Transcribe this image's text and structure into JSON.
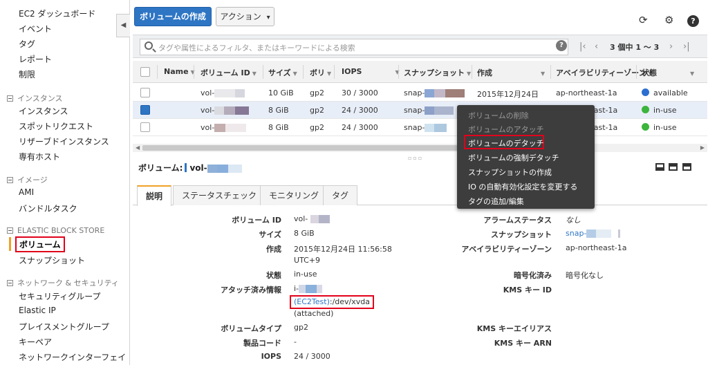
{
  "sidebar": {
    "links_top": [
      "EC2 ダッシュボード",
      "イベント",
      "タグ",
      "レポート",
      "制限"
    ],
    "groups": [
      {
        "title": "インスタンス",
        "items": [
          "インスタンス",
          "スポットリクエスト",
          "リザーブドインスタンス",
          "専有ホスト"
        ]
      },
      {
        "title": "イメージ",
        "items": [
          "AMI",
          "バンドルタスク"
        ]
      },
      {
        "title": "ELASTIC BLOCK STORE",
        "items": [
          "ボリューム",
          "スナップショット"
        ]
      },
      {
        "title": "ネットワーク & セキュリティ",
        "items": [
          "セキュリティグループ",
          "Elastic IP",
          "プレイスメントグループ",
          "キーペア",
          "ネットワークインターフェイ"
        ]
      }
    ],
    "active_item": "ボリューム"
  },
  "toolbar": {
    "create_volume": "ボリュームの作成",
    "actions": "アクション",
    "actions_caret": "▾"
  },
  "search": {
    "placeholder": "タグや属性によるフィルタ、またはキーワードによる検索",
    "help": "?",
    "pager_text": "3 個中 1 ～ 3"
  },
  "grid": {
    "columns": [
      "Name",
      "ボリューム ID",
      "サイズ",
      "ボリ",
      "IOPS",
      "スナップショット",
      "作成",
      "アベイラビリティーゾーン",
      "状態"
    ],
    "rows": [
      {
        "volume_id": "vol-",
        "size": "10 GiB",
        "type": "gp2",
        "iops": "30 / 3000",
        "snapshot": "snap-",
        "created": "2015年12月24日",
        "az": "ap-northeast-1a",
        "state": "available",
        "state_color": "#2c6fd1",
        "selected": false
      },
      {
        "volume_id": "vol-",
        "size": "8 GiB",
        "type": "gp2",
        "iops": "24 / 3000",
        "snapshot": "snap-",
        "created": "",
        "az": "heast-1a",
        "state": "in-use",
        "state_color": "#3bb53b",
        "selected": true
      },
      {
        "volume_id": "vol-",
        "size": "8 GiB",
        "type": "gp2",
        "iops": "24 / 3000",
        "snapshot": "snap-",
        "created": "",
        "az": "heast-1a",
        "state": "in-use",
        "state_color": "#3bb53b",
        "selected": false
      }
    ]
  },
  "context_menu": {
    "items": [
      "ボリュームの削除",
      "ボリュームのアタッチ",
      "ボリュームのデタッチ",
      "ボリュームの強制デタッチ",
      "スナップショットの作成",
      "IO の自動有効化設定を変更する",
      "タグの追加/編集"
    ],
    "highlighted": "ボリュームのデタッチ"
  },
  "detail": {
    "title_label": "ボリューム:",
    "title_value": "vol-",
    "tabs": [
      "説明",
      "ステータスチェック",
      "モニタリング",
      "タグ"
    ],
    "left": {
      "volume_id_label": "ボリューム ID",
      "volume_id": "vol-",
      "size_label": "サイズ",
      "size": "8 GiB",
      "created_label": "作成",
      "created_1": "2015年12月24日 11:56:58",
      "created_2": "UTC+9",
      "state_label": "状態",
      "state": "in-use",
      "attach_label": "アタッチ済み情報",
      "attach_1": "i-",
      "attach_link": "(EC2Test)",
      "attach_path": ":/dev/xvda",
      "attach_3": "(attached)",
      "vol_type_label": "ボリュームタイプ",
      "vol_type": "gp2",
      "product_code_label": "製品コード",
      "product_code": "-",
      "iops_label": "IOPS",
      "iops": "24 / 3000"
    },
    "right": {
      "alarm_label": "アラームステータス",
      "alarm": "なし",
      "snapshot_label": "スナップショット",
      "snapshot": "snap-",
      "az_label": "アベイラビリティーゾーン",
      "az": "ap-northeast-1a",
      "encrypt_label": "暗号化済み",
      "encrypt": "暗号化なし",
      "kms_id_label": "KMS キー ID",
      "kms_alias_label": "KMS キーエイリアス",
      "kms_arn_label": "KMS キー ARN"
    }
  }
}
